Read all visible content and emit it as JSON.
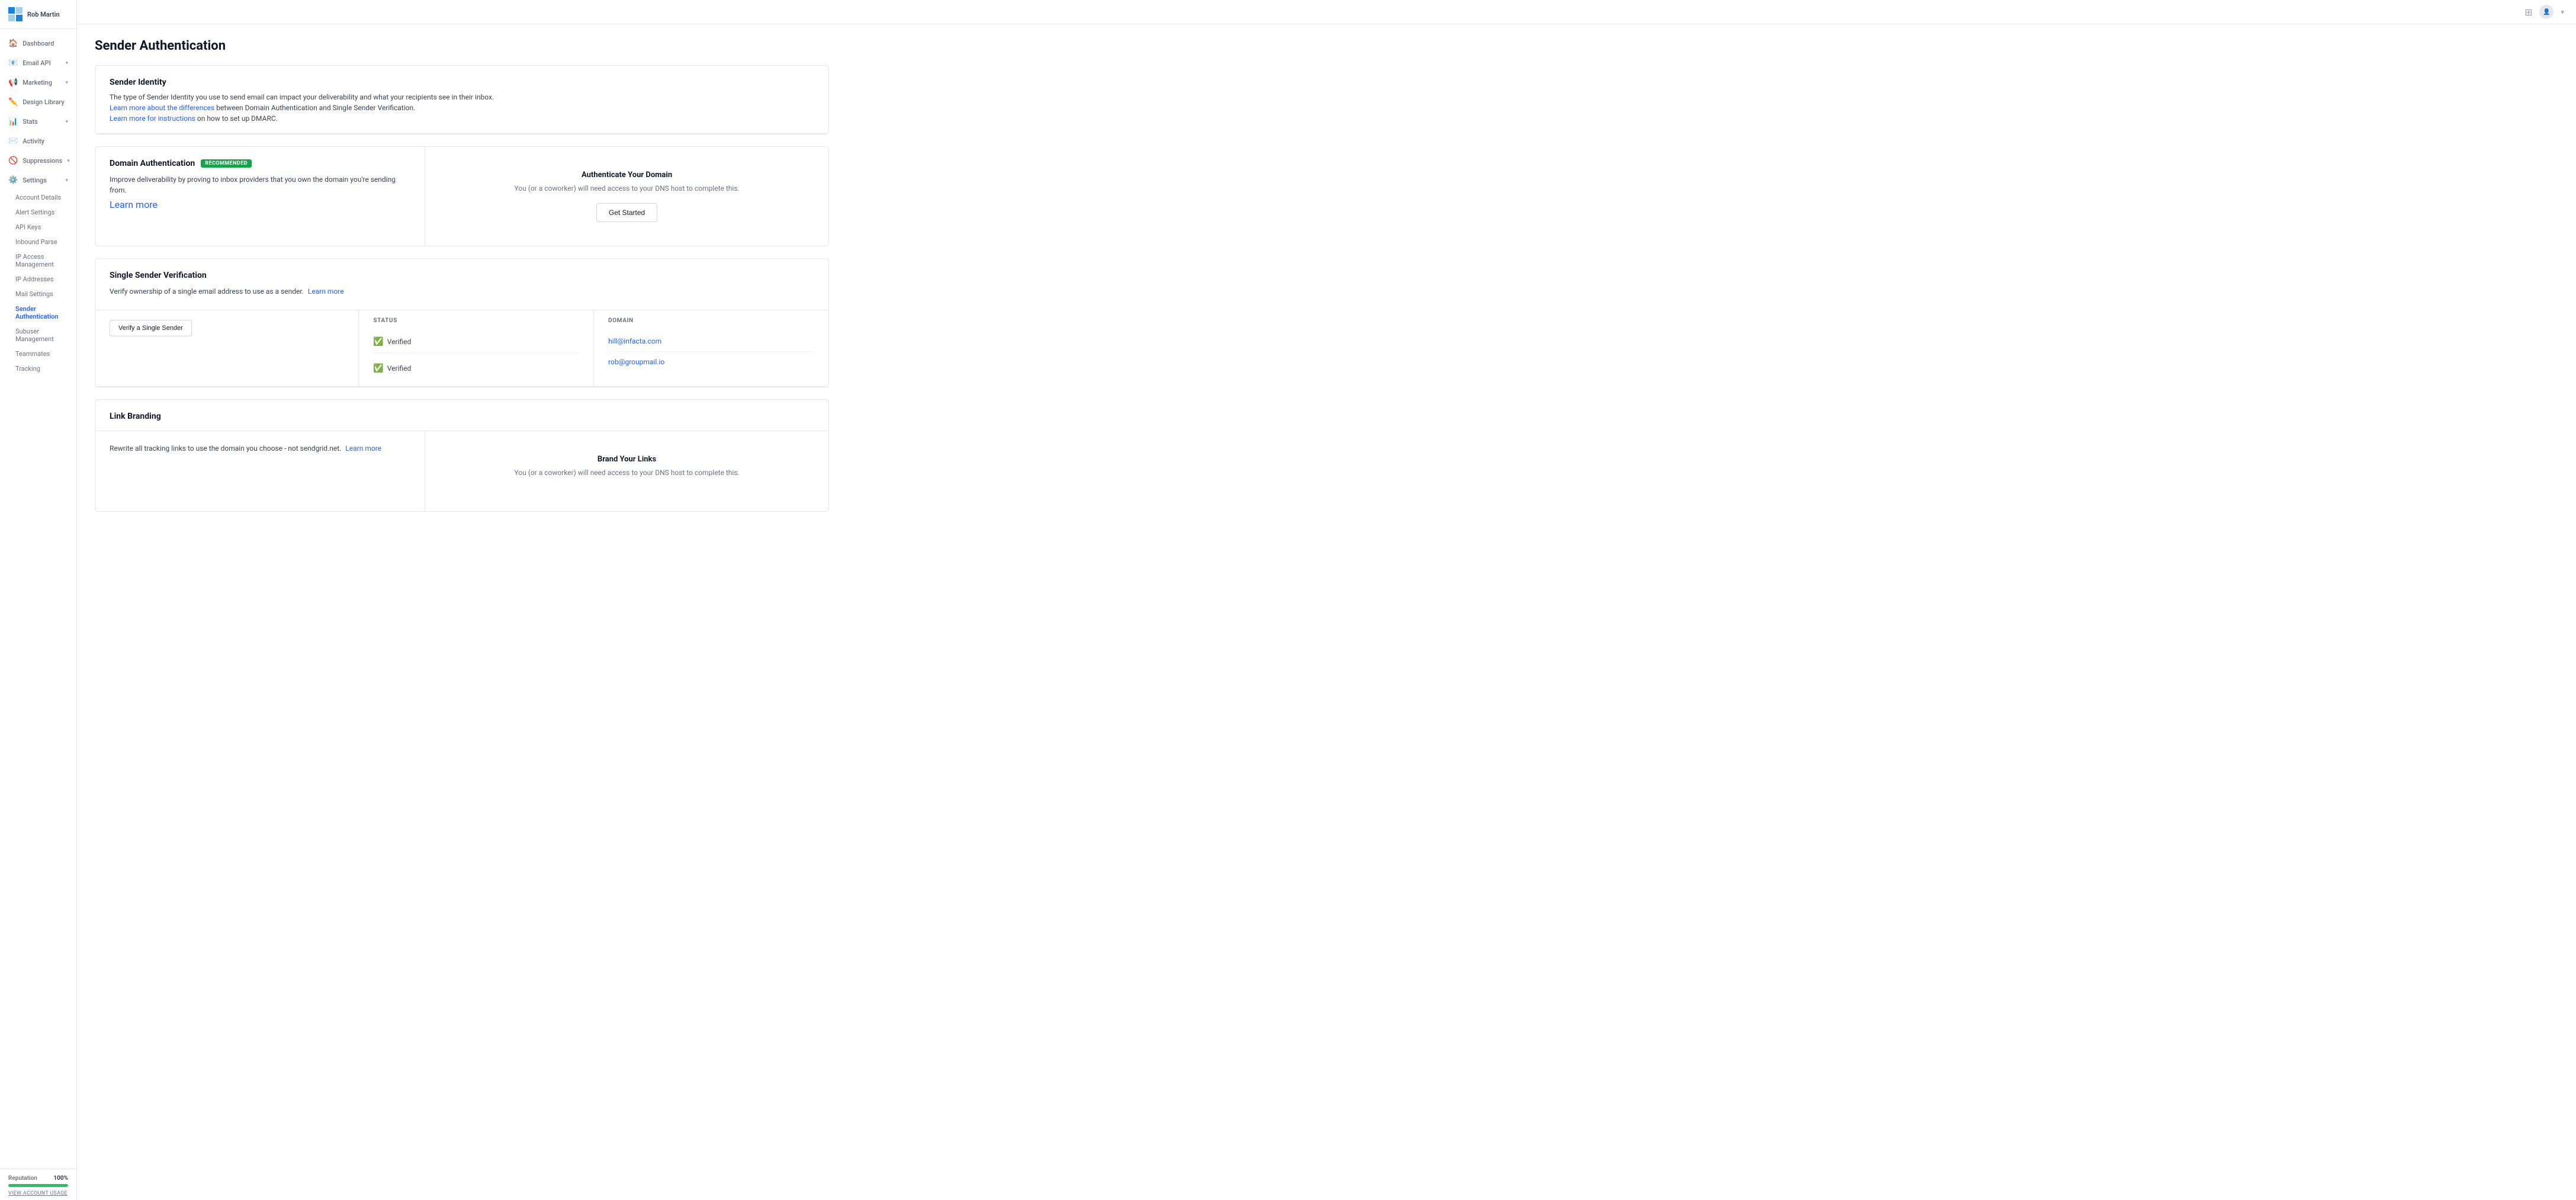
{
  "sidebar": {
    "user_name": "Rob Martin",
    "nav_items": [
      {
        "id": "dashboard",
        "label": "Dashboard",
        "icon": "🏠",
        "has_dropdown": false
      },
      {
        "id": "email-api",
        "label": "Email API",
        "icon": "📧",
        "has_dropdown": true
      },
      {
        "id": "marketing",
        "label": "Marketing",
        "icon": "📢",
        "has_dropdown": true
      },
      {
        "id": "design-library",
        "label": "Design Library",
        "icon": "✏️",
        "has_dropdown": false
      },
      {
        "id": "stats",
        "label": "Stats",
        "icon": "📊",
        "has_dropdown": true
      },
      {
        "id": "activity",
        "label": "Activity",
        "icon": "✉️",
        "has_dropdown": false
      },
      {
        "id": "suppressions",
        "label": "Suppressions",
        "icon": "🚫",
        "has_dropdown": true
      },
      {
        "id": "settings",
        "label": "Settings",
        "icon": "⚙️",
        "has_dropdown": true
      }
    ],
    "settings_sub_items": [
      {
        "id": "account-details",
        "label": "Account Details"
      },
      {
        "id": "alert-settings",
        "label": "Alert Settings"
      },
      {
        "id": "api-keys",
        "label": "API Keys"
      },
      {
        "id": "inbound-parse",
        "label": "Inbound Parse"
      },
      {
        "id": "ip-access-management",
        "label": "IP Access Management"
      },
      {
        "id": "ip-addresses",
        "label": "IP Addresses"
      },
      {
        "id": "mail-settings",
        "label": "Mail Settings"
      },
      {
        "id": "sender-authentication",
        "label": "Sender Authentication",
        "active": true
      },
      {
        "id": "subuser-management",
        "label": "Subuser Management"
      },
      {
        "id": "teammates",
        "label": "Teammates"
      },
      {
        "id": "tracking",
        "label": "Tracking"
      }
    ],
    "reputation": {
      "label": "Reputation",
      "value": 100,
      "display": "100%"
    },
    "view_account_usage": "VIEW ACCOUNT USAGE"
  },
  "topbar": {
    "grid_icon": "⊞",
    "user_icon": "👤",
    "chevron": "▾"
  },
  "page": {
    "title": "Sender Authentication",
    "sender_identity": {
      "title": "Sender Identity",
      "desc1": "The type of Sender Identity you use to send email can impact your deliverability and what your recipients see in their inbox.",
      "link1_text": "Learn more about the differences",
      "desc1_cont": " between Domain Authentication and Single Sender Verification.",
      "link2_text": "Learn more for instructions",
      "desc2_cont": " on how to set up DMARC."
    },
    "domain_auth": {
      "title": "Domain Authentication",
      "badge": "RECOMMENDED",
      "desc": "Improve deliverability by proving to inbox providers that you own the domain you're sending from.",
      "learn_more": "Learn more",
      "cta_title": "Authenticate Your Domain",
      "cta_desc": "You (or a coworker) will need access to your DNS host to complete this.",
      "cta_button": "Get Started"
    },
    "single_sender": {
      "title": "Single Sender Verification",
      "desc": "Verify ownership of a single email address to use as a sender.",
      "learn_more": "Learn more",
      "button": "Verify a Single Sender",
      "col_status": "STATUS",
      "col_domain": "DOMAIN",
      "senders": [
        {
          "status": "Verified",
          "email": "hill@infacta.com"
        },
        {
          "status": "Verified",
          "email": "rob@groupmail.io"
        }
      ]
    },
    "link_branding": {
      "title": "Link Branding",
      "desc": "Rewrite all tracking links to use the domain you choose - not sendgrid.net.",
      "learn_more": "Learn more",
      "cta_title": "Brand Your Links",
      "cta_desc": "You (or a coworker) will need access to your DNS host to complete this."
    }
  }
}
